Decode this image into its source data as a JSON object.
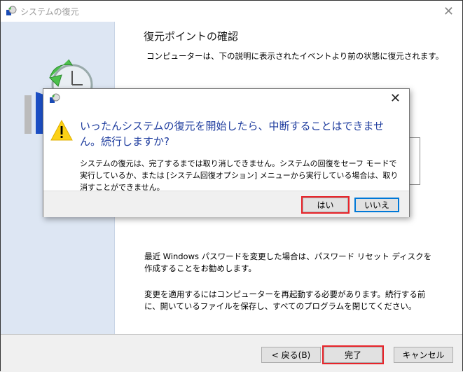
{
  "window": {
    "title": "システムの復元",
    "heading": "復元ポイントの確認",
    "subtitle": "コンピューターは、下の説明に表示されたイベントより前の状態に復元されます。",
    "password_note": "最近 Windows パスワードを変更した場合は、パスワード リセット ディスクを作成することをお勧めします。",
    "restart_note": "変更を適用するにはコンピューターを再起動する必要があります。続行する前に、開いているファイルを保存し、すべてのプログラムを閉じてください。",
    "buttons": {
      "back": "< 戻る(B)",
      "finish": "完了",
      "cancel": "キャンセル"
    }
  },
  "dialog": {
    "message": "いったんシステムの復元を開始したら、中断することはできません。続行しますか?",
    "detail": "システムの復元は、完了するまでは取り消しできません。システムの回復をセーフ モードで実行しているか、または [システム回復オプション] メニューから実行している場合は、取り消すことができません。",
    "buttons": {
      "yes": "はい",
      "no": "いいえ"
    }
  },
  "colors": {
    "highlight": "#e8242a",
    "message": "#1e3c9e",
    "sidebar": "#dde6f3"
  }
}
